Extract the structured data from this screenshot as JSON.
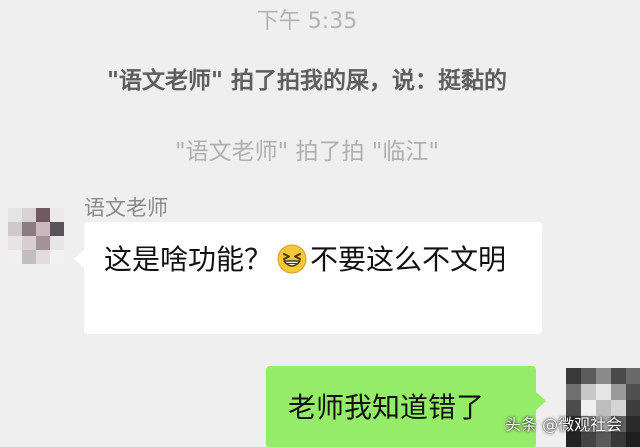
{
  "chat": {
    "timestamp": "下午 5:35",
    "pat_notice_1": "\"语文老师\" 拍了拍我的屎，说：挺黏的",
    "pat_notice_2": "\"语文老师\" 拍了拍 \"临江\"",
    "sender_name": "语文老师",
    "incoming_message": {
      "text_before_emoji": "这是啥功能？",
      "emoji": "grinning-squint-emoji",
      "text_after_emoji": "不要这么不文明"
    },
    "outgoing_message": {
      "text": "老师我知道错了"
    }
  },
  "watermark": {
    "text": "头条 @微观社会"
  },
  "colors": {
    "background": "#efefef",
    "incoming_bubble": "#ffffff",
    "outgoing_bubble": "#95ec69",
    "system_text_dark": "#5e5e5e",
    "system_text_light": "#b0b0b0",
    "emoji_fill": "#f7c73a"
  },
  "avatars": {
    "left": "pixelated-avatar",
    "right": "pixelated-avatar"
  }
}
